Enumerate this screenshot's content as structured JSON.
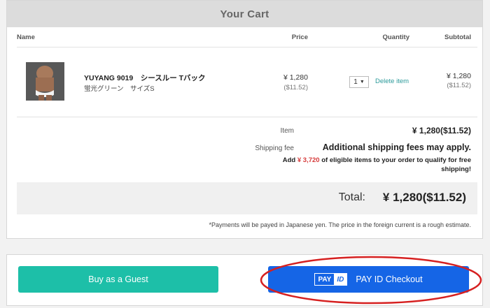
{
  "cart": {
    "title": "Your Cart",
    "columns": {
      "name": "Name",
      "price": "Price",
      "quantity": "Quantity",
      "subtotal": "Subtotal"
    },
    "items": [
      {
        "name": "YUYANG 9019　シースルー Tバック",
        "variant": "蛍光グリーン　サイズS",
        "price": "¥ 1,280",
        "price_usd": "($11.52)",
        "quantity": "1",
        "delete_label": "Delete item",
        "subtotal": "¥ 1,280",
        "subtotal_usd": "($11.52)"
      }
    ],
    "summary": {
      "item_label": "Item",
      "item_value": "¥ 1,280($11.52)",
      "shipping_label": "Shipping fee",
      "shipping_value": "Additional shipping fees may apply.",
      "free_ship_prefix": "Add",
      "free_ship_amount": "¥ 3,720",
      "free_ship_suffix": "of eligible items to your order to qualify for free shipping!"
    },
    "total": {
      "label": "Total:",
      "value": "¥ 1,280($11.52)"
    },
    "note": "*Payments will be payed in Japanese yen. The price in the foreign current is a rough estimate."
  },
  "checkout": {
    "guest_label": "Buy as a Guest",
    "payid_logo_pay": "PAY",
    "payid_logo_id": "ID",
    "payid_label": "PAY ID Checkout"
  },
  "colors": {
    "guest_button": "#1dbfa8",
    "payid_button": "#1565e6",
    "highlight_ellipse": "#d62020",
    "link": "#2b9a9a",
    "free_ship_amount": "#d63b3b"
  },
  "icons": {
    "quantity_caret": "chevron-down-icon"
  }
}
